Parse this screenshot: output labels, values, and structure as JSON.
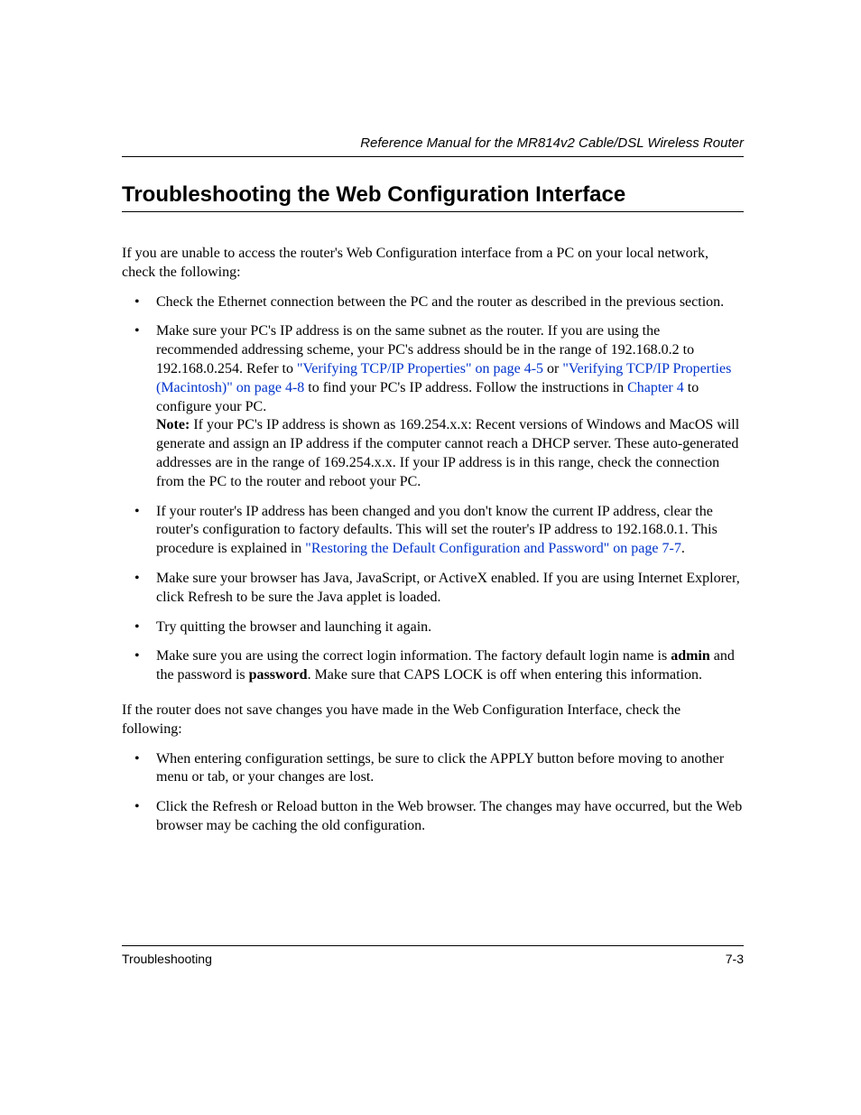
{
  "header": {
    "running_title": "Reference Manual for the MR814v2 Cable/DSL Wireless Router"
  },
  "section": {
    "title": "Troubleshooting the Web Configuration Interface"
  },
  "intro_para": "If you are unable to access the router's Web Configuration interface from a PC on your local network, check the following:",
  "bullets1": {
    "b1": "Check the Ethernet connection between the PC and the router as described in the previous section.",
    "b2": {
      "t1": "Make sure your PC's IP address is on the same subnet as the router. If you are using the recommended addressing scheme, your PC's address should be in the range of 192.168.0.2 to 192.168.0.254. Refer to ",
      "link1": "\"Verifying TCP/IP Properties\" on page 4-5",
      "t2": " or ",
      "link2": "\"Verifying TCP/IP Properties (Macintosh)\" on page 4-8",
      "t3": " to find your PC's IP address. Follow the instructions in ",
      "link3": "Chapter 4",
      "t4": " to configure your PC.",
      "note_label": "Note:",
      "note_body": " If your PC's IP address is shown as 169.254.x.x: Recent versions of Windows and MacOS will generate and assign an IP address if the computer cannot reach a DHCP server. These auto-generated addresses are in the range of 169.254.x.x. If your IP address is in this range, check the connection from the PC to the router and reboot your PC."
    },
    "b3": {
      "t1": "If your router's IP address has been changed and you don't know the current IP address, clear the router's configuration to factory defaults. This will set the router's IP address to 192.168.0.1. This procedure is explained in ",
      "link1": "\"Restoring the Default Configuration and Password\" on page 7-7",
      "t2": "."
    },
    "b4": "Make sure your browser has Java, JavaScript, or ActiveX enabled. If you are using Internet Explorer, click Refresh to be sure the Java applet is loaded.",
    "b5": "Try quitting the browser and launching it again.",
    "b6": {
      "t1": "Make sure you are using the correct login information. The factory default login name is ",
      "bold1": "admin",
      "t2": " and the password is ",
      "bold2": "password",
      "t3": ". Make sure that CAPS LOCK is off when entering this information."
    }
  },
  "mid_para": "If the router does not save changes you have made in the Web Configuration Interface, check the following:",
  "bullets2": {
    "b1": "When entering configuration settings, be sure to click the APPLY button before moving to another menu or tab, or your changes are lost.",
    "b2": "Click the Refresh or Reload button in the Web browser. The changes may have occurred, but the Web browser may be caching the old configuration."
  },
  "footer": {
    "left": "Troubleshooting",
    "right": "7-3"
  }
}
